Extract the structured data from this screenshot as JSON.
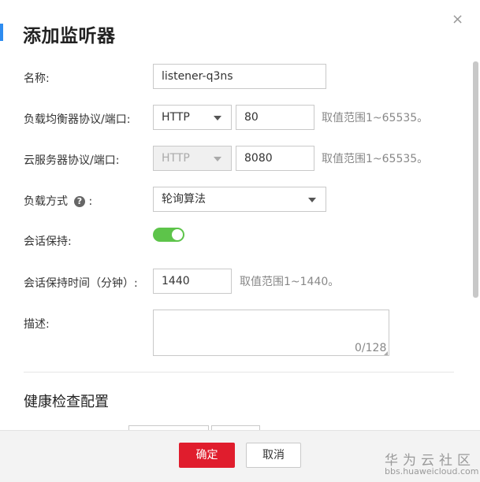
{
  "dialog": {
    "title": "添加监听器",
    "close": "×"
  },
  "fields": {
    "name": {
      "label": "名称:",
      "value": "listener-q3ns"
    },
    "lb_protocol_port": {
      "label": "负载均衡器协议/端口:",
      "protocol": "HTTP",
      "port": "80",
      "hint": "取值范围1~65535。"
    },
    "server_protocol_port": {
      "label": "云服务器协议/端口:",
      "protocol": "HTTP",
      "port": "8080",
      "hint": "取值范围1~65535。"
    },
    "lb_method": {
      "label": "负载方式",
      "help": "?",
      "colon": ":",
      "value": "轮询算法"
    },
    "session_sticky": {
      "label": "会话保持:",
      "enabled": true
    },
    "session_time": {
      "label": "会话保持时间（分钟）:",
      "value": "1440",
      "hint": "取值范围1~1440。"
    },
    "description": {
      "label": "描述:",
      "value": "",
      "counter": "0/128"
    }
  },
  "section_health": {
    "title": "健康检查配置"
  },
  "footer": {
    "ok": "确定",
    "cancel": "取消"
  },
  "watermark": {
    "line1": "华为云社区",
    "line2": "bbs.huaweicloud.com"
  },
  "colors": {
    "accent": "#2e8cf0",
    "primary_button": "#e01d2d",
    "toggle_on": "#5dc44a"
  }
}
